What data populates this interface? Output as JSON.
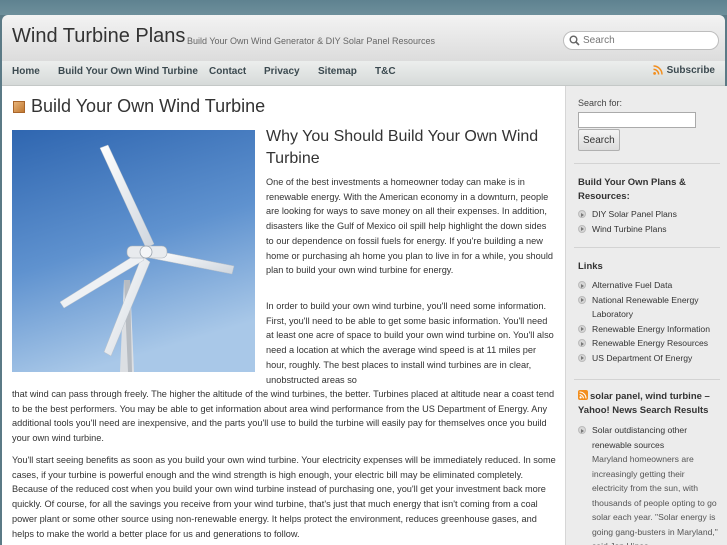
{
  "header": {
    "site_title": "Wind Turbine Plans",
    "tagline": "Build Your Own Wind Generator & DIY Solar Panel Resources",
    "search_placeholder": "Search"
  },
  "nav": {
    "items": [
      "Home",
      "Build Your Own Wind Turbine",
      "Contact",
      "Privacy",
      "Sitemap",
      "T&C"
    ],
    "subscribe": "Subscribe"
  },
  "main": {
    "page_title": "Build Your Own Wind Turbine",
    "article_heading": "Why You Should Build Your Own Wind Turbine",
    "p1": "One of the best investments a homeowner today can make is in renewable energy.  With the American economy in a downturn, people are looking for ways to save money on all their expenses.  In addition, disasters like the Gulf of Mexico oil spill help highlight the down sides to our dependence on fossil fuels for energy.  If you're building a new home or purchasing ah home you plan to live in for a while, you should plan to build your own wind turbine for energy.",
    "p2_top": "In order to build your own wind turbine, you'll need some information.  First, you'll need to be able to get some basic information.  You'll need at least one acre of space to build your own wind turbine on.  You'll also need a location at which the average wind speed is at 11 miles per hour, roughly.  The best places to install wind turbines are in clear, unobstructed areas so",
    "p2_bottom": "that wind can pass through freely.  The higher the altitude of the wind turbines, the better.  Turbines placed at altitude near a coast tend to be the best performers.  You may be able to get information about area wind performance from the US Department of Energy.  Any additional tools you'll need are inexpensive, and the parts you'll use to build the turbine will easily pay for themselves once you build your own wind turbine.",
    "p3": "You'll start seeing benefits as soon as you build your own wind turbine.  Your electricity expenses will be immediately reduced.  In some cases, if your turbine is powerful enough and the wind strength is high enough, your electric bill may be eliminated completely.  Because of the reduced cost when you build your own wind turbine instead of purchasing one, you'll get your investment back more quickly.  Of course, for all the savings you receive from your wind turbine, that's just that much energy that isn't coming from a coal power plant or some other source using non-renewable energy.  It helps protect the environment, reduces greenhouse gases, and helps to make the world a better place for us and generations to follow."
  },
  "sidebar": {
    "search_label": "Search for:",
    "search_button": "Search",
    "plans_heading": "Build Your Own Plans & Resources:",
    "plans_items": [
      "DIY Solar Panel Plans",
      "Wind Turbine Plans"
    ],
    "links_heading": "Links",
    "links_items": [
      "Alternative Fuel Data",
      "National Renewable Energy Laboratory",
      "Renewable Energy Information",
      "Renewable Energy Resources",
      "US Department Of Energy"
    ],
    "rss_heading": "solar panel, wind turbine – Yahoo! News Search Results",
    "news_title": "Solar outdistancing other renewable sources",
    "news_summary": "Maryland homeowners are increasingly getting their electricity from the sun, with thousands of people opting to go solar each year. \"Solar energy is going gang-busters in Maryland,\" said Jon Hines"
  },
  "colors": {
    "background": "#5b7a86",
    "rss_orange": "#f28e1e"
  },
  "icons": {
    "search": "magnifier-icon",
    "subscribe": "rss-icon",
    "page_title": "square-bullet-icon"
  }
}
